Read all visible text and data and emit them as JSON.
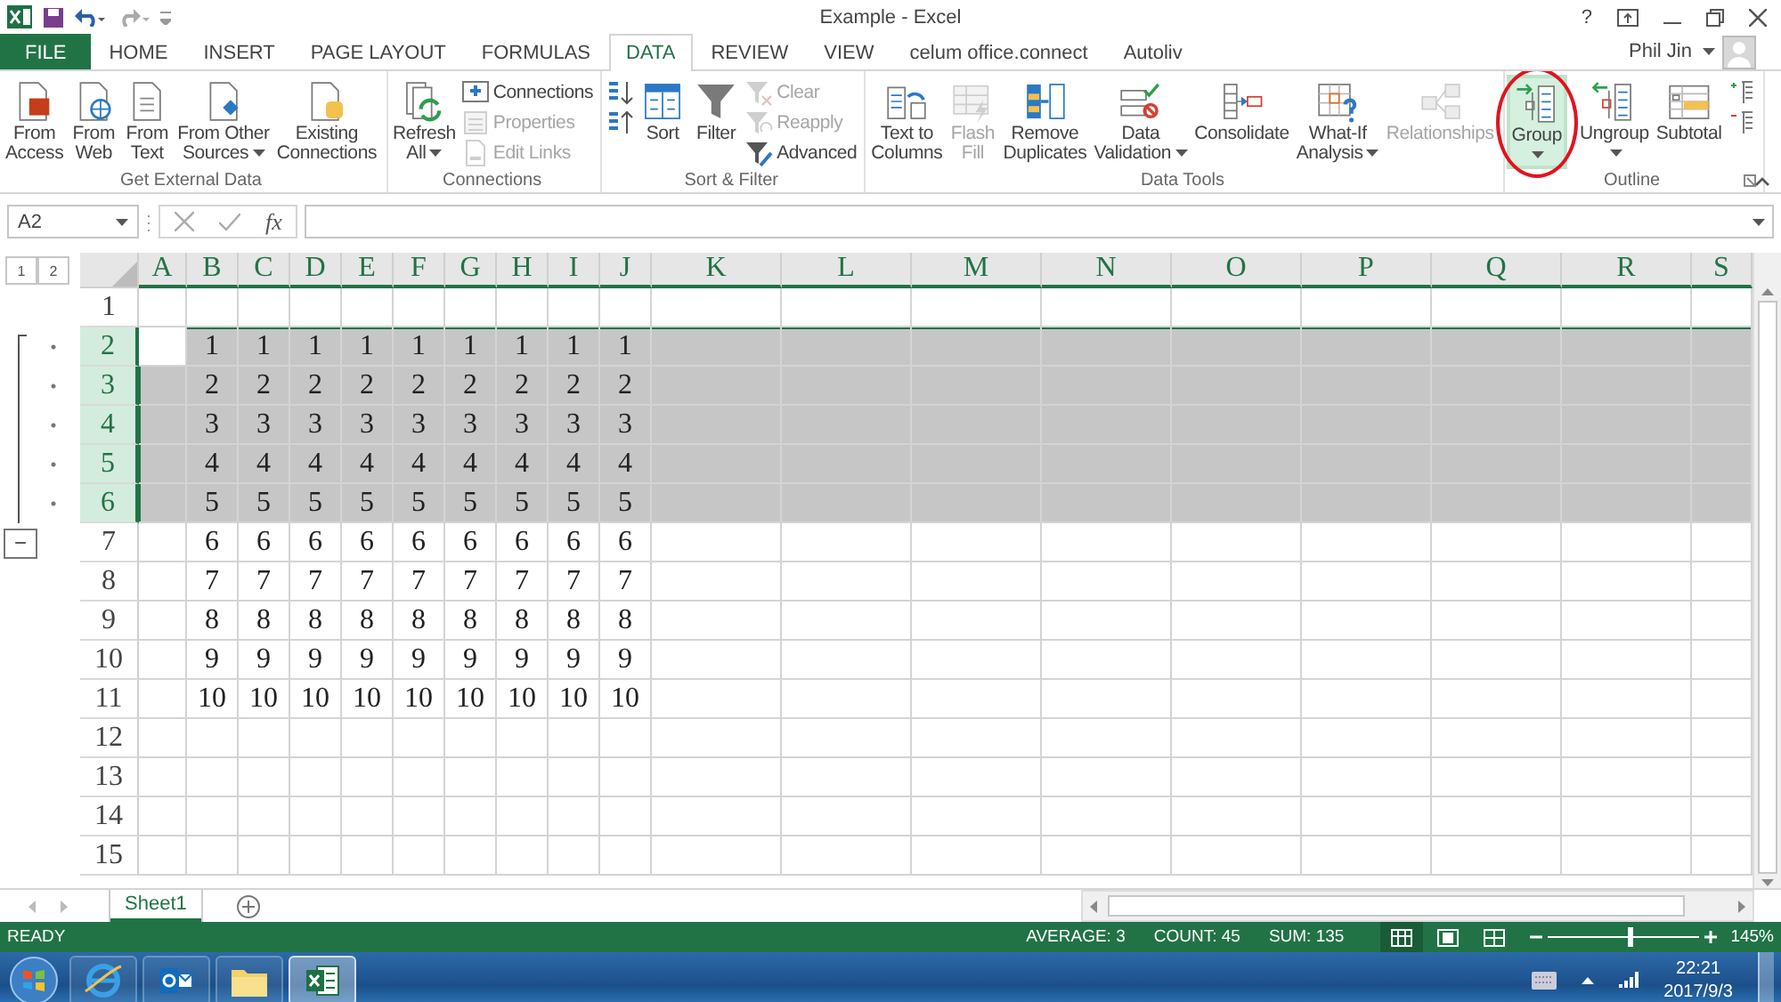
{
  "title_bar": {
    "title": "Example - Excel",
    "help": "?"
  },
  "tabs": [
    {
      "label": "FILE",
      "kind": "file",
      "selected": false
    },
    {
      "label": "HOME",
      "kind": "tab",
      "selected": false
    },
    {
      "label": "INSERT",
      "kind": "tab",
      "selected": false
    },
    {
      "label": "PAGE LAYOUT",
      "kind": "tab",
      "selected": false
    },
    {
      "label": "FORMULAS",
      "kind": "tab",
      "selected": false
    },
    {
      "label": "DATA",
      "kind": "tab",
      "selected": true
    },
    {
      "label": "REVIEW",
      "kind": "tab",
      "selected": false
    },
    {
      "label": "VIEW",
      "kind": "tab",
      "selected": false
    },
    {
      "label": "celum office.connect",
      "kind": "tab",
      "selected": false
    },
    {
      "label": "Autoliv",
      "kind": "tab",
      "selected": false
    }
  ],
  "account": {
    "name": "Phil Jin"
  },
  "ribbon": {
    "groups": [
      {
        "name": "Get External Data",
        "dialog_launcher": false,
        "items": [
          {
            "kind": "large",
            "label": "From\nAccess",
            "disabled": false,
            "dropdown": false,
            "highlighted": false,
            "circled": false
          },
          {
            "kind": "large",
            "label": "From\nWeb",
            "disabled": false,
            "dropdown": false,
            "highlighted": false,
            "circled": false
          },
          {
            "kind": "large",
            "label": "From\nText",
            "disabled": false,
            "dropdown": false,
            "highlighted": false,
            "circled": false
          },
          {
            "kind": "large",
            "label": "From Other\nSources",
            "disabled": false,
            "dropdown": true,
            "highlighted": false,
            "circled": false
          },
          {
            "kind": "large",
            "label": "Existing\nConnections",
            "disabled": false,
            "dropdown": false,
            "highlighted": false,
            "circled": false
          }
        ]
      },
      {
        "name": "Connections",
        "dialog_launcher": false,
        "items": [
          {
            "kind": "large",
            "label": "Refresh\nAll",
            "disabled": false,
            "dropdown": true,
            "highlighted": false,
            "circled": false
          },
          {
            "kind": "stack",
            "items": [
              {
                "label": "Connections",
                "disabled": false
              },
              {
                "label": "Properties",
                "disabled": true
              },
              {
                "label": "Edit Links",
                "disabled": true
              }
            ]
          }
        ]
      },
      {
        "name": "Sort & Filter",
        "dialog_launcher": false,
        "items": [
          {
            "kind": "stack",
            "items": [
              {
                "disabled": false
              },
              {
                "disabled": false
              }
            ]
          },
          {
            "kind": "large",
            "label": "Sort",
            "disabled": false,
            "dropdown": false,
            "highlighted": false,
            "circled": false
          },
          {
            "kind": "large",
            "label": "Filter",
            "disabled": false,
            "dropdown": false,
            "highlighted": false,
            "circled": false
          },
          {
            "kind": "stack",
            "items": [
              {
                "label": "Clear",
                "disabled": true
              },
              {
                "label": "Reapply",
                "disabled": true
              },
              {
                "label": "Advanced",
                "disabled": false
              }
            ]
          }
        ]
      },
      {
        "name": "Data Tools",
        "dialog_launcher": false,
        "items": [
          {
            "kind": "large",
            "label": "Text to\nColumns",
            "disabled": false,
            "dropdown": false,
            "highlighted": false,
            "circled": false
          },
          {
            "kind": "large",
            "label": "Flash\nFill",
            "disabled": true,
            "dropdown": false,
            "highlighted": false,
            "circled": false
          },
          {
            "kind": "large",
            "label": "Remove\nDuplicates",
            "disabled": false,
            "dropdown": false,
            "highlighted": false,
            "circled": false
          },
          {
            "kind": "large",
            "label": "Data\nValidation",
            "disabled": false,
            "dropdown": true,
            "highlighted": false,
            "circled": false
          },
          {
            "kind": "large",
            "label": "Consolidate",
            "disabled": false,
            "dropdown": false,
            "highlighted": false,
            "circled": false
          },
          {
            "kind": "large",
            "label": "What-If\nAnalysis",
            "disabled": false,
            "dropdown": true,
            "highlighted": false,
            "circled": false
          },
          {
            "kind": "large",
            "label": "Relationships",
            "disabled": true,
            "dropdown": false,
            "highlighted": false,
            "circled": false
          }
        ]
      },
      {
        "name": "Outline",
        "dialog_launcher": true,
        "items": [
          {
            "kind": "large",
            "label": "Group",
            "disabled": false,
            "dropdown": true,
            "highlighted": true,
            "circled": true
          },
          {
            "kind": "large",
            "label": "Ungroup",
            "disabled": false,
            "dropdown": true,
            "highlighted": false,
            "circled": false
          },
          {
            "kind": "large",
            "label": "Subtotal",
            "disabled": false,
            "dropdown": false,
            "highlighted": false,
            "circled": false
          },
          {
            "kind": "stack",
            "items": [
              {
                "disabled": false
              },
              {
                "disabled": false
              }
            ]
          }
        ]
      }
    ]
  },
  "formula_bar": {
    "name_box": "A2",
    "function_label": "fx"
  },
  "outline": {
    "levels": [
      "1",
      "2"
    ]
  },
  "columns": [
    {
      "label": "A"
    },
    {
      "label": "B"
    },
    {
      "label": "C"
    },
    {
      "label": "D"
    },
    {
      "label": "E"
    },
    {
      "label": "F"
    },
    {
      "label": "G"
    },
    {
      "label": "H"
    },
    {
      "label": "I"
    },
    {
      "label": "J"
    },
    {
      "label": "K"
    },
    {
      "label": "L"
    },
    {
      "label": "M"
    },
    {
      "label": "N"
    },
    {
      "label": "O"
    },
    {
      "label": "P"
    },
    {
      "label": "Q"
    },
    {
      "label": "R"
    },
    {
      "label": "S"
    }
  ],
  "rows": [
    {
      "kind": "row",
      "header": "1",
      "selected": false
    },
    {
      "kind": "group",
      "collapse": "−",
      "children": [
        {
          "kind": "row",
          "header": "2",
          "selected": true,
          "cells": [
            "1",
            "1",
            "1",
            "1",
            "1",
            "1",
            "1",
            "1",
            "1"
          ]
        },
        {
          "kind": "row",
          "header": "3",
          "selected": true,
          "cells": [
            "2",
            "2",
            "2",
            "2",
            "2",
            "2",
            "2",
            "2",
            "2"
          ]
        },
        {
          "kind": "row",
          "header": "4",
          "selected": true,
          "cells": [
            "3",
            "3",
            "3",
            "3",
            "3",
            "3",
            "3",
            "3",
            "3"
          ]
        },
        {
          "kind": "row",
          "header": "5",
          "selected": true,
          "cells": [
            "4",
            "4",
            "4",
            "4",
            "4",
            "4",
            "4",
            "4",
            "4"
          ]
        },
        {
          "kind": "row",
          "header": "6",
          "selected": true,
          "cells": [
            "5",
            "5",
            "5",
            "5",
            "5",
            "5",
            "5",
            "5",
            "5"
          ]
        }
      ]
    },
    {
      "kind": "row",
      "header": "7",
      "selected": false,
      "cells": [
        "6",
        "6",
        "6",
        "6",
        "6",
        "6",
        "6",
        "6",
        "6"
      ]
    },
    {
      "kind": "row",
      "header": "8",
      "selected": false,
      "cells": [
        "7",
        "7",
        "7",
        "7",
        "7",
        "7",
        "7",
        "7",
        "7"
      ]
    },
    {
      "kind": "row",
      "header": "9",
      "selected": false,
      "cells": [
        "8",
        "8",
        "8",
        "8",
        "8",
        "8",
        "8",
        "8",
        "8"
      ]
    },
    {
      "kind": "row",
      "header": "10",
      "selected": false,
      "cells": [
        "9",
        "9",
        "9",
        "9",
        "9",
        "9",
        "9",
        "9",
        "9"
      ]
    },
    {
      "kind": "row",
      "header": "11",
      "selected": false,
      "cells": [
        "10",
        "10",
        "10",
        "10",
        "10",
        "10",
        "10",
        "10",
        "10"
      ]
    },
    {
      "kind": "row",
      "header": "12",
      "selected": false
    },
    {
      "kind": "row",
      "header": "13",
      "selected": false
    },
    {
      "kind": "row",
      "header": "14",
      "selected": false
    },
    {
      "kind": "row",
      "header": "15",
      "selected": false
    }
  ],
  "sheet_tabs": [
    {
      "label": "Sheet1",
      "selected": true
    }
  ],
  "status_bar": {
    "mode": "READY",
    "stats": [
      "AVERAGE: 3",
      "COUNT: 45",
      "SUM: 135"
    ],
    "views": [
      {
        "selected": true
      },
      {
        "selected": false
      },
      {
        "selected": false
      }
    ],
    "zoom": {
      "level": 0.55,
      "label": "145%"
    }
  },
  "taskbar": {
    "apps": [
      {
        "selected": false
      },
      {
        "selected": false
      },
      {
        "selected": false
      },
      {
        "selected": true
      }
    ],
    "time": "22:21",
    "date": "2017/9/3"
  }
}
